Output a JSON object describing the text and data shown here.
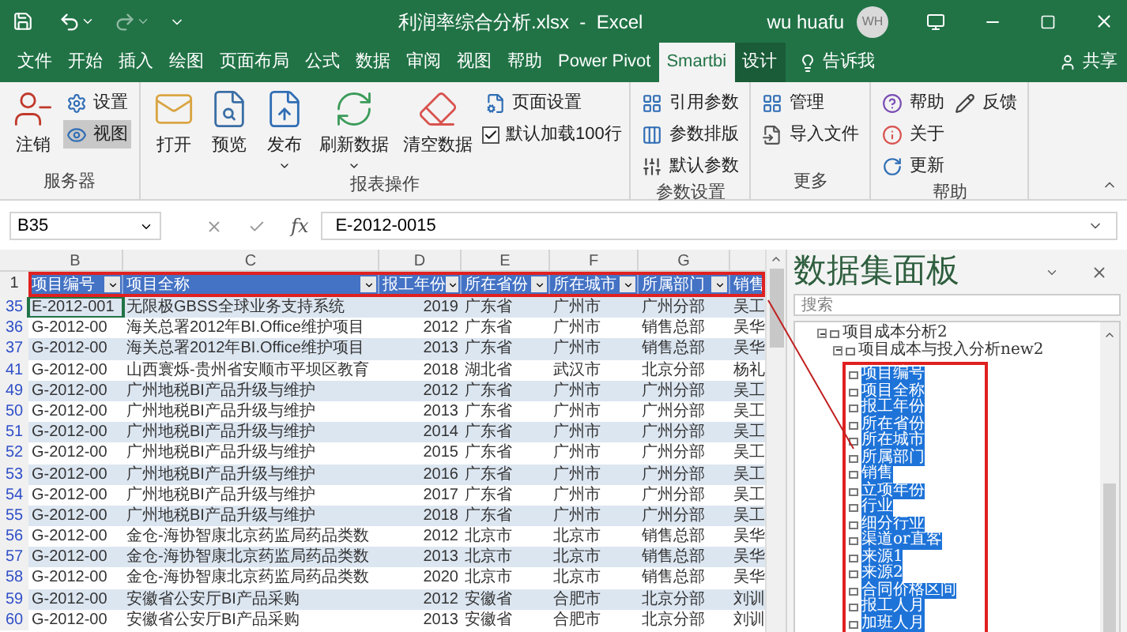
{
  "title_bar": {
    "title": "利润率综合分析.xlsx  -  Excel",
    "user": "wu huafu",
    "avatar": "WH"
  },
  "tabs": [
    {
      "label": "文件",
      "selected": false,
      "contextual": false
    },
    {
      "label": "开始",
      "selected": false,
      "contextual": false
    },
    {
      "label": "插入",
      "selected": false,
      "contextual": false
    },
    {
      "label": "绘图",
      "selected": false,
      "contextual": false
    },
    {
      "label": "页面布局",
      "selected": false,
      "contextual": false
    },
    {
      "label": "公式",
      "selected": false,
      "contextual": false
    },
    {
      "label": "数据",
      "selected": false,
      "contextual": false
    },
    {
      "label": "审阅",
      "selected": false,
      "contextual": false
    },
    {
      "label": "视图",
      "selected": false,
      "contextual": false
    },
    {
      "label": "帮助",
      "selected": false,
      "contextual": false
    },
    {
      "label": "Power Pivot",
      "selected": false,
      "contextual": false
    },
    {
      "label": "Smartbi",
      "selected": true,
      "contextual": false
    },
    {
      "label": "设计",
      "selected": false,
      "contextual": true
    }
  ],
  "tell_me": "告诉我",
  "share": "共享",
  "ribbon": {
    "groups": [
      {
        "label": "服务器",
        "large": [
          {
            "label": "注销",
            "dropdown": false
          }
        ],
        "columns": [
          [
            {
              "kind": "button",
              "label": "设置",
              "pressed": false
            },
            {
              "kind": "button",
              "label": "视图",
              "pressed": true
            }
          ]
        ]
      },
      {
        "label": "报表操作",
        "large": [
          {
            "label": "打开",
            "dropdown": false
          },
          {
            "label": "预览",
            "dropdown": false
          },
          {
            "label": "发布",
            "dropdown": true
          },
          {
            "label": "刷新数据",
            "dropdown": true
          },
          {
            "label": "清空数据",
            "dropdown": false
          }
        ],
        "columns": [
          [
            {
              "kind": "button",
              "label": "页面设置",
              "pressed": false
            },
            {
              "kind": "checkbox",
              "label": "默认加载100行",
              "checked": true
            }
          ]
        ]
      },
      {
        "label": "参数设置",
        "columns": [
          [
            {
              "kind": "button",
              "label": "引用参数",
              "pressed": false
            },
            {
              "kind": "button",
              "label": "参数排版",
              "pressed": false
            },
            {
              "kind": "button",
              "label": "默认参数",
              "pressed": false
            }
          ]
        ]
      },
      {
        "label": "更多",
        "columns": [
          [
            {
              "kind": "button",
              "label": "管理",
              "pressed": false
            },
            {
              "kind": "button",
              "label": "导入文件",
              "pressed": false
            }
          ]
        ]
      },
      {
        "label": "帮助",
        "columns": [
          [
            {
              "kind": "button",
              "label": "帮助",
              "pressed": false
            },
            {
              "kind": "button",
              "label": "关于",
              "pressed": false
            },
            {
              "kind": "button",
              "label": "更新",
              "pressed": false
            }
          ],
          [
            {
              "kind": "button",
              "label": "反馈",
              "pressed": false
            }
          ]
        ]
      }
    ]
  },
  "formula_bar": {
    "name_box": "B35",
    "fx": "fx",
    "value": "E-2012-0015"
  },
  "sheet": {
    "column_letters": [
      "B",
      "C",
      "D",
      "E",
      "F",
      "G"
    ],
    "header_row": "1",
    "headers": [
      "项目编号",
      "项目全称",
      "报工年份",
      "所在省份",
      "所在城市",
      "所属部门",
      "销售"
    ],
    "rows": [
      {
        "number": "35",
        "active": true,
        "cells": [
          "E-2012-001",
          "无限极GBSS全球业务支持系统",
          "2019",
          "广东省",
          "广州市",
          "广州分部",
          "吴工"
        ]
      },
      {
        "number": "36",
        "active": false,
        "cells": [
          "G-2012-00",
          "海关总署2012年BI.Office维护项目",
          "2012",
          "广东省",
          "广州市",
          "销售总部",
          "吴华"
        ]
      },
      {
        "number": "37",
        "active": false,
        "cells": [
          "G-2012-00",
          "海关总署2012年BI.Office维护项目",
          "2013",
          "广东省",
          "广州市",
          "销售总部",
          "吴华"
        ]
      },
      {
        "number": "41",
        "active": false,
        "cells": [
          "G-2012-00",
          "山西寰烁-贵州省安顺市平坝区教育",
          "2018",
          "湖北省",
          "武汉市",
          "北京分部",
          "杨礼"
        ]
      },
      {
        "number": "49",
        "active": false,
        "cells": [
          "G-2012-00",
          "广州地税BI产品升级与维护",
          "2012",
          "广东省",
          "广州市",
          "广州分部",
          "吴工"
        ]
      },
      {
        "number": "50",
        "active": false,
        "cells": [
          "G-2012-00",
          "广州地税BI产品升级与维护",
          "2013",
          "广东省",
          "广州市",
          "广州分部",
          "吴工"
        ]
      },
      {
        "number": "51",
        "active": false,
        "cells": [
          "G-2012-00",
          "广州地税BI产品升级与维护",
          "2014",
          "广东省",
          "广州市",
          "广州分部",
          "吴工"
        ]
      },
      {
        "number": "52",
        "active": false,
        "cells": [
          "G-2012-00",
          "广州地税BI产品升级与维护",
          "2015",
          "广东省",
          "广州市",
          "广州分部",
          "吴工"
        ]
      },
      {
        "number": "53",
        "active": false,
        "cells": [
          "G-2012-00",
          "广州地税BI产品升级与维护",
          "2016",
          "广东省",
          "广州市",
          "广州分部",
          "吴工"
        ]
      },
      {
        "number": "54",
        "active": false,
        "cells": [
          "G-2012-00",
          "广州地税BI产品升级与维护",
          "2017",
          "广东省",
          "广州市",
          "广州分部",
          "吴工"
        ]
      },
      {
        "number": "55",
        "active": false,
        "cells": [
          "G-2012-00",
          "广州地税BI产品升级与维护",
          "2018",
          "广东省",
          "广州市",
          "广州分部",
          "吴工"
        ]
      },
      {
        "number": "56",
        "active": false,
        "cells": [
          "G-2012-00",
          "金仓-海协智康北京药监局药品类数",
          "2012",
          "北京市",
          "北京市",
          "销售总部",
          "吴华"
        ]
      },
      {
        "number": "57",
        "active": false,
        "cells": [
          "G-2012-00",
          "金仓-海协智康北京药监局药品类数",
          "2013",
          "北京市",
          "北京市",
          "销售总部",
          "吴华"
        ]
      },
      {
        "number": "58",
        "active": false,
        "cells": [
          "G-2012-00",
          "金仓-海协智康北京药监局药品类数",
          "2020",
          "北京市",
          "北京市",
          "销售总部",
          "吴华"
        ]
      },
      {
        "number": "59",
        "active": false,
        "cells": [
          "G-2012-00",
          "安徽省公安厅BI产品采购",
          "2012",
          "安徽省",
          "合肥市",
          "北京分部",
          "刘训"
        ]
      },
      {
        "number": "60",
        "active": false,
        "cells": [
          "G-2012-00",
          "安徽省公安厅BI产品采购",
          "2013",
          "安徽省",
          "合肥市",
          "北京分部",
          "刘训"
        ]
      }
    ]
  },
  "panel": {
    "title": "数据集面板",
    "search_placeholder": "搜索",
    "tree": [
      {
        "label": "项目成本分析2",
        "expanded": true,
        "selected": false,
        "children": [
          {
            "label": "项目成本与投入分析new2",
            "expanded": true,
            "selected": false,
            "children": [
              {
                "label": "项目编号",
                "selected": true
              },
              {
                "label": "项目全称",
                "selected": true
              },
              {
                "label": "报工年份",
                "selected": true
              },
              {
                "label": "所在省份",
                "selected": true
              },
              {
                "label": "所在城市",
                "selected": true
              },
              {
                "label": "所属部门",
                "selected": true
              },
              {
                "label": "销售",
                "selected": true
              },
              {
                "label": "立项年份",
                "selected": true
              },
              {
                "label": "行业",
                "selected": true
              },
              {
                "label": "细分行业",
                "selected": true
              },
              {
                "label": "渠道or直客",
                "selected": true
              },
              {
                "label": "来源1",
                "selected": true
              },
              {
                "label": "来源2",
                "selected": true
              },
              {
                "label": "合同价格区间",
                "selected": true
              },
              {
                "label": "报工人月",
                "selected": true
              },
              {
                "label": "加班人月",
                "selected": true
              }
            ]
          }
        ]
      }
    ]
  }
}
